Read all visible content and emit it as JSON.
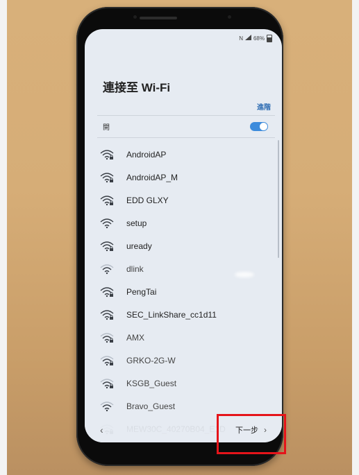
{
  "status_bar": {
    "nfc_icon": "N",
    "signal_icon": "signal-icon",
    "battery_text": "68%",
    "battery_icon": "battery-icon"
  },
  "page": {
    "title": "連接至 Wi-Fi",
    "advanced_label": "進階",
    "toggle_label": "開",
    "toggle_state": "on",
    "accent_color": "#3c8bdc"
  },
  "networks": [
    {
      "name": "AndroidAP",
      "secured": true,
      "strength": 3
    },
    {
      "name": "AndroidAP_M",
      "secured": true,
      "strength": 3
    },
    {
      "name": "EDD GLXY",
      "secured": true,
      "strength": 3
    },
    {
      "name": "setup",
      "secured": false,
      "strength": 3
    },
    {
      "name": "uready",
      "secured": true,
      "strength": 3
    },
    {
      "name": "dlink",
      "secured": false,
      "strength": 2
    },
    {
      "name": "PengTai",
      "secured": true,
      "strength": 3
    },
    {
      "name": "SEC_LinkShare_cc1d11",
      "secured": true,
      "strength": 3
    },
    {
      "name": "AMX",
      "secured": true,
      "strength": 2
    },
    {
      "name": "GRKO-2G-W",
      "secured": true,
      "strength": 2
    },
    {
      "name": "KSGB_Guest",
      "secured": true,
      "strength": 2
    },
    {
      "name": "Bravo_Guest",
      "secured": false,
      "strength": 2
    },
    {
      "name": "MEW30C_40270B04_E1D",
      "secured": true,
      "strength": 1
    }
  ],
  "bottom_nav": {
    "back_label": "‹",
    "next_label": "下一步",
    "next_chevron": "›"
  },
  "highlight_color": "#e5141a"
}
